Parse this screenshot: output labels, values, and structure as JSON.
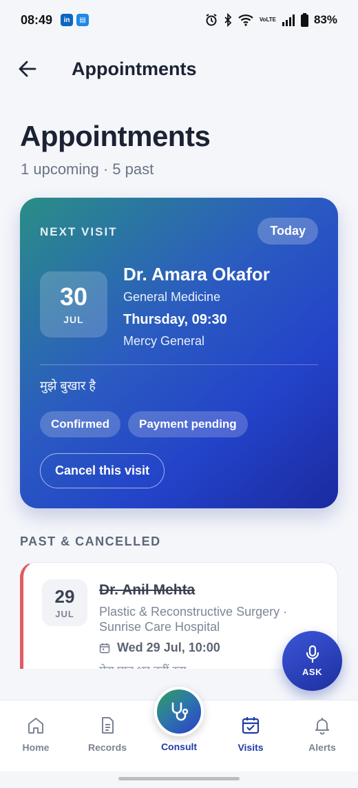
{
  "status_bar": {
    "time": "08:49",
    "battery": "83%",
    "volte_top": "Vo",
    "volte_bottom": "LTE",
    "apps": [
      {
        "name": "linkedin",
        "label": "in",
        "color": "#0a66c2"
      },
      {
        "name": "app2",
        "label": "▤",
        "color": "#1e88e5"
      }
    ]
  },
  "header": {
    "title": "Appointments"
  },
  "page": {
    "title": "Appointments",
    "subtitle": "1 upcoming · 5 past"
  },
  "next_visit": {
    "label": "NEXT VISIT",
    "badge": "Today",
    "day": "30",
    "month": "JUL",
    "doctor": "Dr. Amara Okafor",
    "specialty": "General Medicine",
    "datetime": "Thursday, 09:30",
    "location": "Mercy General",
    "note": "मुझे बुखार है",
    "chips": [
      "Confirmed",
      "Payment pending"
    ],
    "cancel_label": "Cancel this visit"
  },
  "past": {
    "section_label": "PAST & CANCELLED",
    "items": [
      {
        "day": "29",
        "month": "JUL",
        "doctor": "Dr. Anil Mehta",
        "specialty_line1": "Plastic & Reconstructive Surgery ·",
        "specialty_line2": "Sunrise Care Hospital",
        "when": "Wed 29 Jul, 10:00",
        "note": "मेरा घाव भर नहीं रहा",
        "status_color": "#e15b62"
      }
    ]
  },
  "fab": {
    "label": "ASK"
  },
  "bottom_nav": {
    "items": [
      {
        "label": "Home",
        "icon": "home-icon"
      },
      {
        "label": "Records",
        "icon": "document-icon"
      },
      {
        "label": "Consult",
        "icon": "stethoscope-icon"
      },
      {
        "label": "Visits",
        "icon": "calendar-check-icon",
        "active": true
      },
      {
        "label": "Alerts",
        "icon": "bell-icon"
      }
    ]
  },
  "colors": {
    "accent": "#1f3aa7",
    "card_gradient_start": "#2a8e86",
    "card_gradient_end": "#1b2aa0",
    "cancelled": "#e15b62"
  }
}
